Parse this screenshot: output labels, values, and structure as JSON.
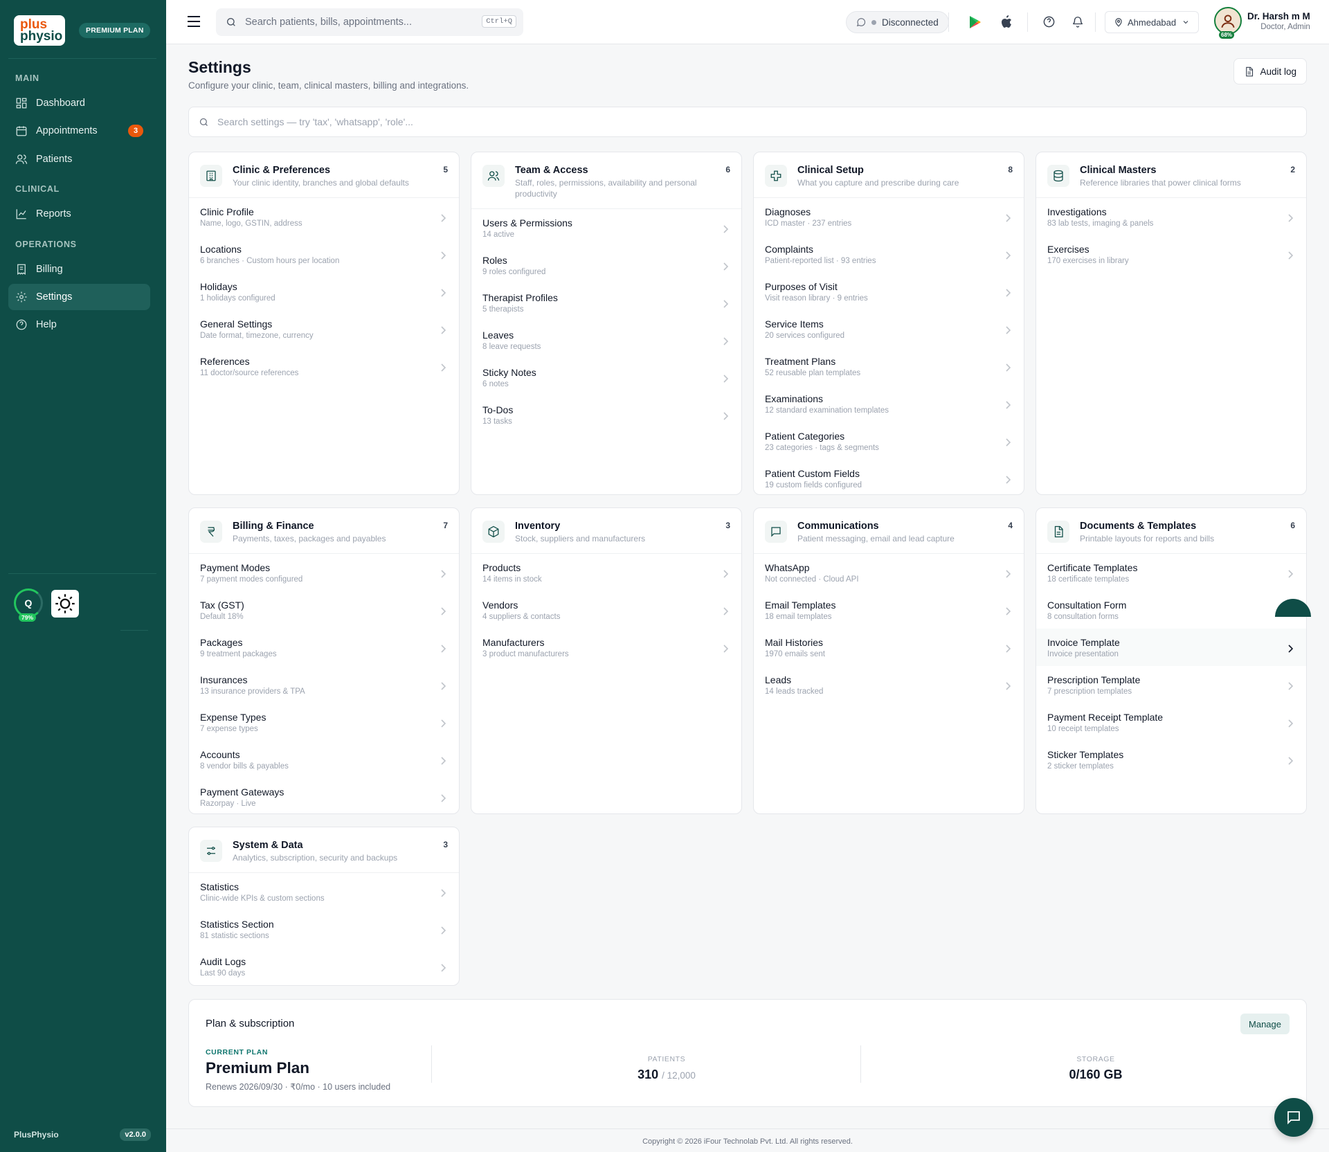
{
  "brand": {
    "logo_line1": "plus",
    "logo_line2": "physio",
    "plan_badge": "PREMIUM PLAN",
    "footer_name": "PlusPhysio",
    "version": "v2.0.0"
  },
  "sidebar": {
    "sections": {
      "main": "MAIN",
      "clinical": "CLINICAL",
      "operations": "OPERATIONS"
    },
    "items": [
      {
        "label": "Dashboard",
        "icon": "dashboard-icon"
      },
      {
        "label": "Appointments",
        "icon": "calendar-icon",
        "badge": "3"
      },
      {
        "label": "Patients",
        "icon": "users-icon"
      },
      {
        "label": "Reports",
        "icon": "chart-line-icon"
      },
      {
        "label": "Billing",
        "icon": "receipt-icon"
      },
      {
        "label": "Settings",
        "icon": "gear-icon",
        "active": true
      },
      {
        "label": "Help",
        "icon": "help-circle-icon"
      }
    ],
    "widget": {
      "letter": "Q",
      "percent": "79%"
    }
  },
  "topbar": {
    "search_placeholder": "Search patients, bills, appointments...",
    "shortcut": "Ctrl+Q",
    "connection": "Disconnected",
    "location": "Ahmedabad",
    "user": {
      "name": "Dr. Harsh m M",
      "role": "Doctor, Admin",
      "percent": "68%"
    }
  },
  "page": {
    "title": "Settings",
    "subtitle": "Configure your clinic, team, clinical masters, billing and integrations.",
    "audit_button": "Audit log",
    "search_placeholder": "Search settings — try 'tax', 'whatsapp', 'role'..."
  },
  "cards": [
    {
      "title": "Clinic & Preferences",
      "desc": "Your clinic identity, branches and global defaults",
      "count": "5",
      "icon": "building-icon",
      "items": [
        {
          "t": "Clinic Profile",
          "s": "Name, logo, GSTIN, address"
        },
        {
          "t": "Locations",
          "s": "6 branches · Custom hours per location"
        },
        {
          "t": "Holidays",
          "s": "1 holidays configured"
        },
        {
          "t": "General Settings",
          "s": "Date format, timezone, currency"
        },
        {
          "t": "References",
          "s": "11 doctor/source references"
        }
      ]
    },
    {
      "title": "Team & Access",
      "desc": "Staff, roles, permissions, availability and personal productivity",
      "count": "6",
      "icon": "team-icon",
      "items": [
        {
          "t": "Users & Permissions",
          "s": "14 active"
        },
        {
          "t": "Roles",
          "s": "9 roles configured"
        },
        {
          "t": "Therapist Profiles",
          "s": "5 therapists"
        },
        {
          "t": "Leaves",
          "s": "8 leave requests"
        },
        {
          "t": "Sticky Notes",
          "s": "6 notes"
        },
        {
          "t": "To-Dos",
          "s": "13 tasks"
        }
      ]
    },
    {
      "title": "Clinical Setup",
      "desc": "What you capture and prescribe during care",
      "count": "8",
      "icon": "medical-cross-icon",
      "items": [
        {
          "t": "Diagnoses",
          "s": "ICD master · 237 entries"
        },
        {
          "t": "Complaints",
          "s": "Patient-reported list · 93 entries"
        },
        {
          "t": "Purposes of Visit",
          "s": "Visit reason library · 9 entries"
        },
        {
          "t": "Service Items",
          "s": "20 services configured"
        },
        {
          "t": "Treatment Plans",
          "s": "52 reusable plan templates"
        },
        {
          "t": "Examinations",
          "s": "12 standard examination templates"
        },
        {
          "t": "Patient Categories",
          "s": "23 categories · tags & segments"
        },
        {
          "t": "Patient Custom Fields",
          "s": "19 custom fields configured"
        }
      ]
    },
    {
      "title": "Clinical Masters",
      "desc": "Reference libraries that power clinical forms",
      "count": "2",
      "icon": "database-icon",
      "items": [
        {
          "t": "Investigations",
          "s": "83 lab tests, imaging & panels"
        },
        {
          "t": "Exercises",
          "s": "170 exercises in library"
        }
      ]
    },
    {
      "title": "Billing & Finance",
      "desc": "Payments, taxes, packages and payables",
      "count": "7",
      "icon": "rupee-icon",
      "items": [
        {
          "t": "Payment Modes",
          "s": "7 payment modes configured"
        },
        {
          "t": "Tax (GST)",
          "s": "Default 18%"
        },
        {
          "t": "Packages",
          "s": "9 treatment packages"
        },
        {
          "t": "Insurances",
          "s": "13 insurance providers & TPA"
        },
        {
          "t": "Expense Types",
          "s": "7 expense types"
        },
        {
          "t": "Accounts",
          "s": "8 vendor bills & payables"
        },
        {
          "t": "Payment Gateways",
          "s": "Razorpay · Live"
        }
      ]
    },
    {
      "title": "Inventory",
      "desc": "Stock, suppliers and manufacturers",
      "count": "3",
      "icon": "box-icon",
      "items": [
        {
          "t": "Products",
          "s": "14 items in stock"
        },
        {
          "t": "Vendors",
          "s": "4 suppliers & contacts"
        },
        {
          "t": "Manufacturers",
          "s": "3 product manufacturers"
        }
      ]
    },
    {
      "title": "Communications",
      "desc": "Patient messaging, email and lead capture",
      "count": "4",
      "icon": "message-icon",
      "items": [
        {
          "t": "WhatsApp",
          "s": "Not connected · Cloud API"
        },
        {
          "t": "Email Templates",
          "s": "18 email templates"
        },
        {
          "t": "Mail Histories",
          "s": "1970 emails sent"
        },
        {
          "t": "Leads",
          "s": "14 leads tracked"
        }
      ]
    },
    {
      "title": "Documents & Templates",
      "desc": "Printable layouts for reports and bills",
      "count": "6",
      "icon": "document-icon",
      "items": [
        {
          "t": "Certificate Templates",
          "s": "18 certificate templates"
        },
        {
          "t": "Consultation Form",
          "s": "8 consultation forms"
        },
        {
          "t": "Invoice Template",
          "s": "Invoice presentation"
        },
        {
          "t": "Prescription Template",
          "s": "7 prescription templates"
        },
        {
          "t": "Payment Receipt Template",
          "s": "10 receipt templates"
        },
        {
          "t": "Sticker Templates",
          "s": "2 sticker templates"
        }
      ]
    },
    {
      "title": "System & Data",
      "desc": "Analytics, subscription, security and backups",
      "count": "3",
      "icon": "sliders-icon",
      "items": [
        {
          "t": "Statistics",
          "s": "Clinic-wide KPIs & custom sections"
        },
        {
          "t": "Statistics Section",
          "s": "81 statistic sections"
        },
        {
          "t": "Audit Logs",
          "s": "Last 90 days"
        }
      ]
    }
  ],
  "plan": {
    "heading": "Plan & subscription",
    "manage": "Manage",
    "current_label": "CURRENT PLAN",
    "name": "Premium Plan",
    "renews": "Renews 2026/09/30 · ₹0/mo · 10 users included",
    "patients_label": "PATIENTS",
    "patients_value": "310",
    "patients_of": "/ 12,000",
    "storage_label": "STORAGE",
    "storage_value": "0/160 GB"
  },
  "footer": {
    "copyright": "Copyright © 2026 iFour Technolab Pvt. Ltd. All rights reserved."
  }
}
